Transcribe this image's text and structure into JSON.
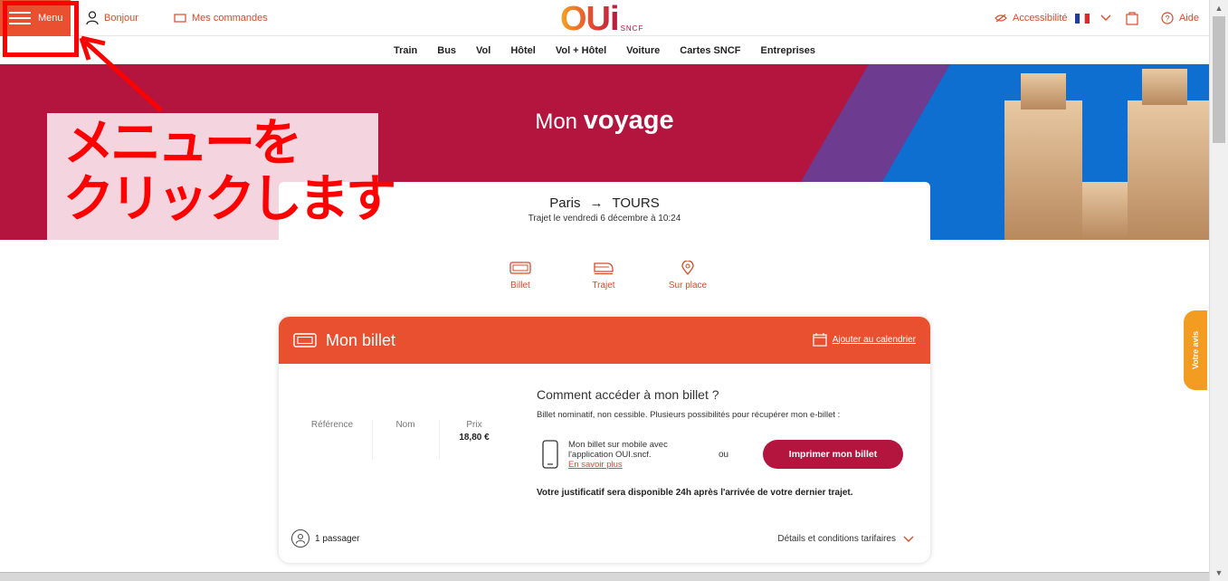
{
  "header": {
    "menu_label": "Menu",
    "bonjour": "Bonjour",
    "commandes": "Mes commandes",
    "logo_main": "OUi",
    "logo_sub": "SNCF",
    "accessibilite": "Accessibilité",
    "aide": "Aide"
  },
  "nav": {
    "items": [
      "Train",
      "Bus",
      "Vol",
      "Hôtel",
      "Vol + Hôtel",
      "Voiture",
      "Cartes SNCF",
      "Entreprises"
    ]
  },
  "hero": {
    "title_light": "Mon",
    "title_bold": "voyage"
  },
  "annotation": {
    "line1": "メニューを",
    "line2": "クリックします"
  },
  "route": {
    "from": "Paris",
    "arrow": "→",
    "to": "TOURS",
    "subtitle": "Trajet le vendredi 6 décembre à 10:24"
  },
  "tabs": {
    "billet": "Billet",
    "trajet": "Trajet",
    "sur_place": "Sur place"
  },
  "ticket": {
    "title": "Mon billet",
    "calendar_link": "Ajouter au calendrier",
    "reference_label": "Référence",
    "nom_label": "Nom",
    "prix_label": "Prix",
    "prix_value": "18,80 €",
    "howto_title": "Comment accéder à mon billet ?",
    "howto_sub": "Billet nominatif, non cessible. Plusieurs possibilités pour récupérer mon e-billet :",
    "mobile_line1": "Mon billet sur mobile avec",
    "mobile_line2": "l'application OUI.sncf.",
    "mobile_link": "En savoir plus",
    "ou": "ou",
    "print_button": "Imprimer mon billet",
    "justificatif": "Votre justificatif sera disponible 24h après l'arrivée de votre dernier trajet.",
    "passengers": "1 passager",
    "details": "Détails et conditions tarifaires"
  },
  "feedback": "Votre avis",
  "colors": {
    "orange": "#e9502f",
    "burgundy": "#b4153f",
    "feedback": "#f29c22",
    "annotation": "#ff0000"
  }
}
